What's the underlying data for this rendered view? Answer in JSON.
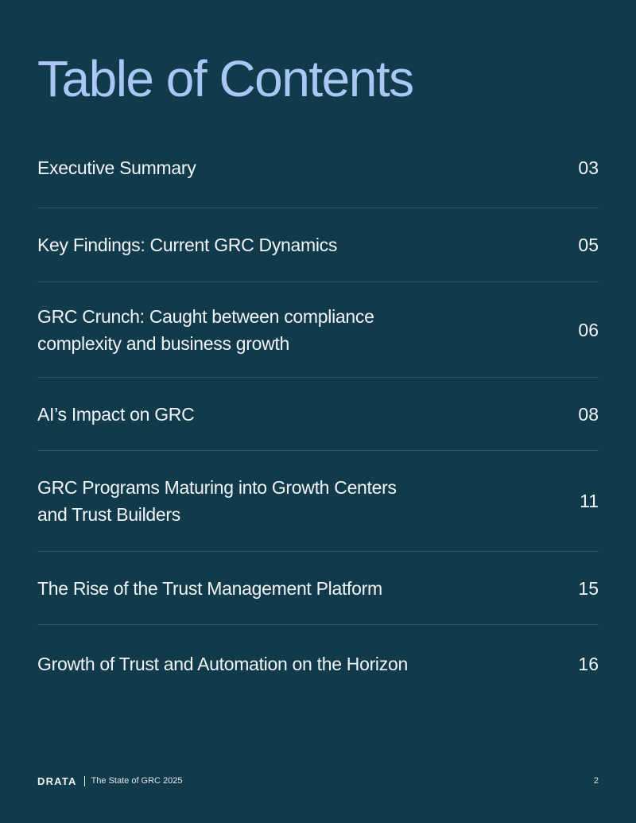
{
  "page": {
    "title": "Table of Contents"
  },
  "toc": {
    "items": [
      {
        "label": "Executive Summary",
        "page": "03"
      },
      {
        "label": "Key Findings: Current GRC Dynamics",
        "page": "05"
      },
      {
        "label": "GRC Crunch: Caught between compliance complexity and business growth",
        "page": "06"
      },
      {
        "label": "AI’s Impact on GRC",
        "page": "08"
      },
      {
        "label": "GRC Programs Maturing into Growth Centers and Trust Builders",
        "page": "11"
      },
      {
        "label": "The Rise of the Trust Management Platform",
        "page": "15"
      },
      {
        "label": "Growth of Trust and Automation on the Horizon",
        "page": "16"
      }
    ]
  },
  "footer": {
    "brand": "DRATA",
    "document_title": "The State of GRC 2025",
    "page_number": "2"
  },
  "colors": {
    "background": "#113a4b",
    "title": "#a9c6f5",
    "text": "#f1f5f8",
    "divider": "#2d5667"
  }
}
